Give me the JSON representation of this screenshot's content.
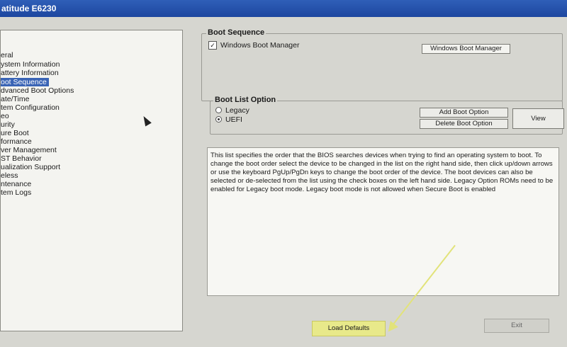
{
  "window": {
    "title": "atitude E6230"
  },
  "tree": {
    "items": [
      "eral",
      "ystem Information",
      "attery Information",
      "oot Sequence",
      "dvanced Boot Options",
      "ate/Time",
      "tem Configuration",
      "eo",
      "urity",
      "ure Boot",
      "formance",
      "ver Management",
      "ST Behavior",
      "ualization Support",
      "eless",
      "ntenance",
      "tem Logs"
    ],
    "selected_index": 3
  },
  "boot_sequence": {
    "title": "Boot Sequence",
    "entries": [
      {
        "label": "Windows Boot Manager",
        "checked": true
      }
    ],
    "order_list": [
      "Windows Boot Manager"
    ]
  },
  "boot_list_option": {
    "title": "Boot List Option",
    "options": [
      "Legacy",
      "UEFI"
    ],
    "selected": "UEFI",
    "add_label": "Add Boot Option",
    "delete_label": "Delete Boot Option",
    "view_label": "View"
  },
  "description": "This list specifies the order that the BIOS searches devices when trying to find an operating system to boot. To change the boot order select the device to be changed in the list on the right hand side, then click up/down arrows or use the keyboard PgUp/PgDn keys to change the boot order of the device. The boot devices can also be selected or de-selected from the list using the check boxes on the left hand side. Legacy Option ROMs need to be enabled for Legacy boot mode. Legacy boot mode is not allowed when Secure Boot is enabled",
  "footer": {
    "load_defaults_label": "Load Defaults",
    "exit_label": "Exit"
  },
  "colors": {
    "selection": "#3a64b5",
    "highlight": "#e8e98a"
  }
}
